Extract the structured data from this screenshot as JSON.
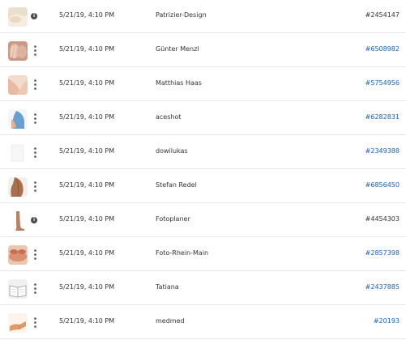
{
  "rows": [
    {
      "date": "5/21/19, 4:10 PM",
      "contributor": "Patrizier-Design",
      "asset_id": "#2454147",
      "id_link": false,
      "action_icon": "info-icon",
      "thumb": "skin-tone-image"
    },
    {
      "date": "5/21/19, 4:10 PM",
      "contributor": "Günter Menzl",
      "asset_id": "#6508982",
      "id_link": true,
      "action_icon": "kebab-menu-icon",
      "thumb": "face-hands-image"
    },
    {
      "date": "5/21/19, 4:10 PM",
      "contributor": "Matthias Haas",
      "asset_id": "#5754956",
      "id_link": true,
      "action_icon": "kebab-menu-icon",
      "thumb": "shoulder-image"
    },
    {
      "date": "5/21/19, 4:10 PM",
      "contributor": "aceshot",
      "asset_id": "#6282831",
      "id_link": true,
      "action_icon": "kebab-menu-icon",
      "thumb": "blue-shirt-image"
    },
    {
      "date": "5/21/19, 4:10 PM",
      "contributor": "dowilukas",
      "asset_id": "#2349388",
      "id_link": true,
      "action_icon": "kebab-menu-icon",
      "thumb": "blank-paper-image"
    },
    {
      "date": "5/21/19, 4:10 PM",
      "contributor": "Stefan Redel",
      "asset_id": "#6856450",
      "id_link": true,
      "action_icon": "kebab-menu-icon",
      "thumb": "back-image"
    },
    {
      "date": "5/21/19, 4:10 PM",
      "contributor": "Fotoplaner",
      "asset_id": "#4454303",
      "id_link": false,
      "action_icon": "info-icon",
      "thumb": "leg-image"
    },
    {
      "date": "5/21/19, 4:10 PM",
      "contributor": "Foto-Rhein-Main",
      "asset_id": "#2857398",
      "id_link": true,
      "action_icon": "kebab-menu-icon",
      "thumb": "massage-image"
    },
    {
      "date": "5/21/19, 4:10 PM",
      "contributor": "Tatiana",
      "asset_id": "#2437885",
      "id_link": true,
      "action_icon": "kebab-menu-icon",
      "thumb": "open-book-image"
    },
    {
      "date": "5/21/19, 4:10 PM",
      "contributor": "medmed",
      "asset_id": "#20193",
      "id_link": true,
      "action_icon": "kebab-menu-icon",
      "thumb": "arm-image"
    }
  ],
  "colors": {
    "link": "#1a5fb4",
    "text": "#333333",
    "divider": "#e6e6e6"
  }
}
